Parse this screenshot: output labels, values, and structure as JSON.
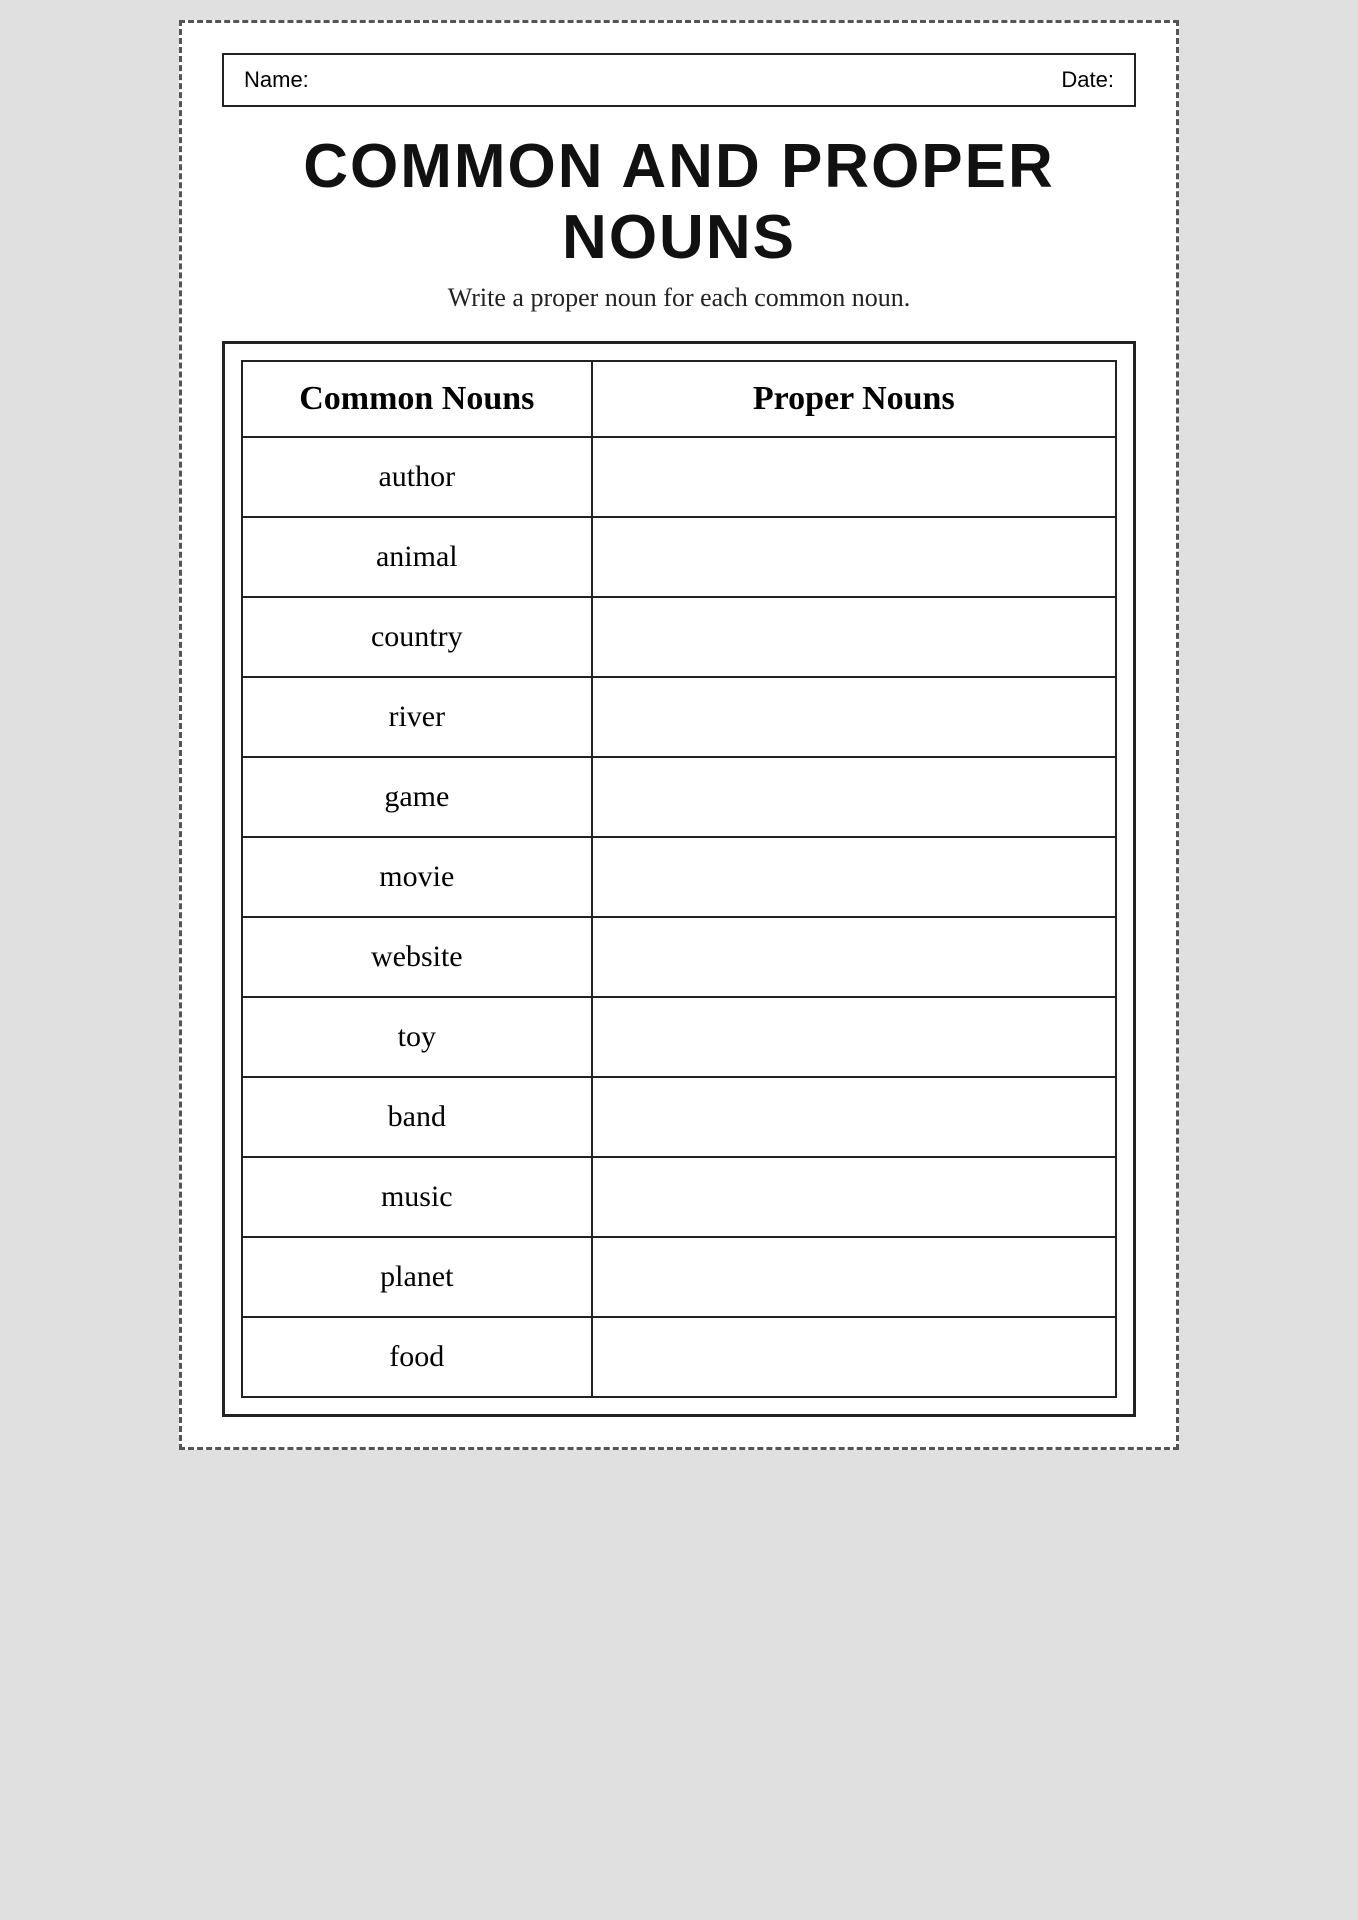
{
  "header": {
    "name_label": "Name:",
    "date_label": "Date:"
  },
  "title": "COMMON AND PROPER NOUNS",
  "subtitle": "Write a proper noun for each common noun.",
  "table": {
    "col_common": "Common Nouns",
    "col_proper": "Proper Nouns",
    "rows": [
      {
        "common": "author",
        "proper": ""
      },
      {
        "common": "animal",
        "proper": ""
      },
      {
        "common": "country",
        "proper": ""
      },
      {
        "common": "river",
        "proper": ""
      },
      {
        "common": "game",
        "proper": ""
      },
      {
        "common": "movie",
        "proper": ""
      },
      {
        "common": "website",
        "proper": ""
      },
      {
        "common": "toy",
        "proper": ""
      },
      {
        "common": "band",
        "proper": ""
      },
      {
        "common": "music",
        "proper": ""
      },
      {
        "common": "planet",
        "proper": ""
      },
      {
        "common": "food",
        "proper": ""
      }
    ]
  }
}
